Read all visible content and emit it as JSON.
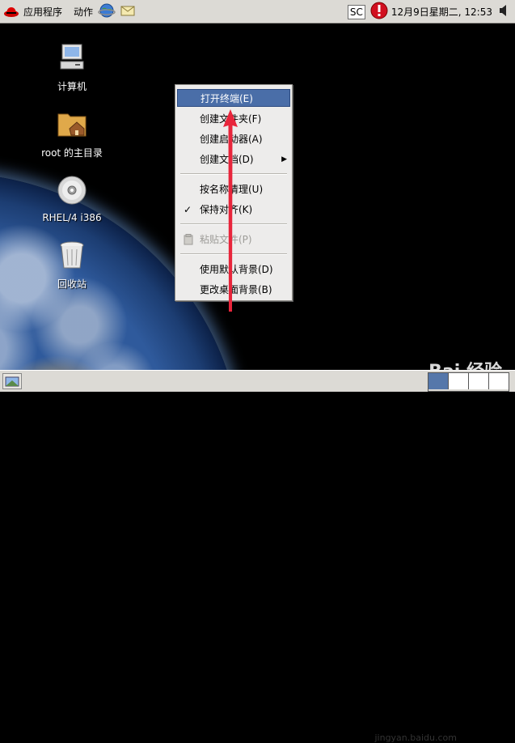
{
  "top_panel": {
    "applications_label": "应用程序",
    "actions_label": "动作",
    "sc_label": "SC",
    "clock": "12月9日星期二, 12:53"
  },
  "desktop_icons": [
    {
      "label": "计算机",
      "icon": "computer-icon"
    },
    {
      "label": "root 的主目录",
      "icon": "home-folder-icon"
    },
    {
      "label": "RHEL/4 i386",
      "icon": "cdrom-icon"
    },
    {
      "label": "回收站",
      "icon": "trash-icon"
    }
  ],
  "context_menu": {
    "items": [
      {
        "label": "打开终端(E)",
        "active": true
      },
      {
        "label": "创建文件夹(F)"
      },
      {
        "label": "创建启动器(A)"
      },
      {
        "label": "创建文档(D)",
        "submenu": true
      },
      {
        "label": "按名称清理(U)"
      },
      {
        "label": "保持对齐(K)",
        "checked": true
      },
      {
        "label": "粘贴文件(P)",
        "disabled": true
      },
      {
        "label": "使用默认背景(D)"
      },
      {
        "label": "更改桌面背景(B)"
      }
    ]
  },
  "watermark": {
    "brand": "Bai 经验",
    "sub": "jingyan.baidu.com"
  },
  "colors": {
    "panel": "#dcdad5",
    "menu_highlight": "#4a6ea8",
    "arrow": "#e8253b"
  }
}
